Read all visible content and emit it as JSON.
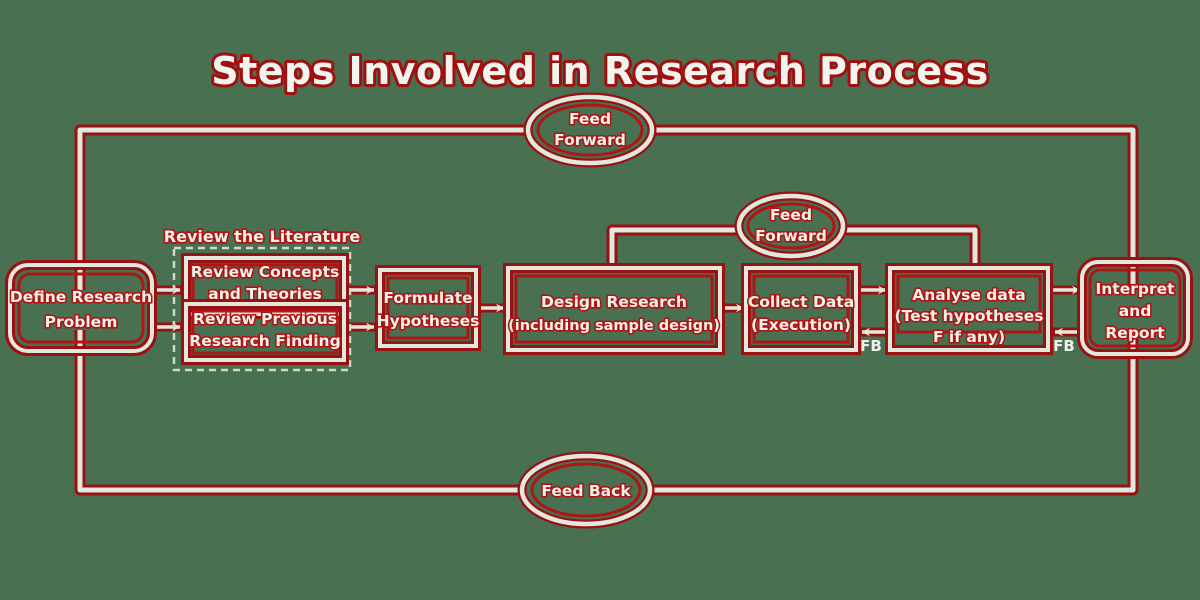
{
  "page": {
    "title": "Steps Involved in Research Process",
    "background_color": "#4a7052",
    "accent_color": "#991111",
    "line_color": "#e3e8de",
    "text_color": "#eef3ea"
  },
  "nodes": {
    "define_problem": {
      "line1": "Define Research",
      "line2": "Problem"
    },
    "group_literature": {
      "label": "Review the Literature"
    },
    "review_concepts": {
      "line1": "Review Concepts",
      "line2": "and Theories"
    },
    "review_previous": {
      "line1": "Review Previous",
      "line2": "Research Finding"
    },
    "formulate": {
      "line1": "Formulate",
      "line2": "Hypotheses"
    },
    "design_research": {
      "line1": "Design Research",
      "line2": "(including sample design)"
    },
    "collect_data": {
      "line1": "Collect Data",
      "line2": "(Execution)"
    },
    "analyse_data": {
      "line1": "Analyse data",
      "line2": "(Test hypotheses",
      "line3": "F if any)"
    },
    "interpret_report": {
      "line1": "Interpret",
      "line2": "and",
      "line3": "Report"
    }
  },
  "loops": {
    "feed_forward_top": {
      "line1": "Feed",
      "line2": "Forward"
    },
    "feed_forward_mid": {
      "line1": "Feed",
      "line2": "Forward"
    },
    "feed_back_bottom": {
      "label": "Feed Back"
    }
  },
  "feedback_labels": {
    "fb_collect": "FB",
    "fb_analyse": "FB"
  }
}
